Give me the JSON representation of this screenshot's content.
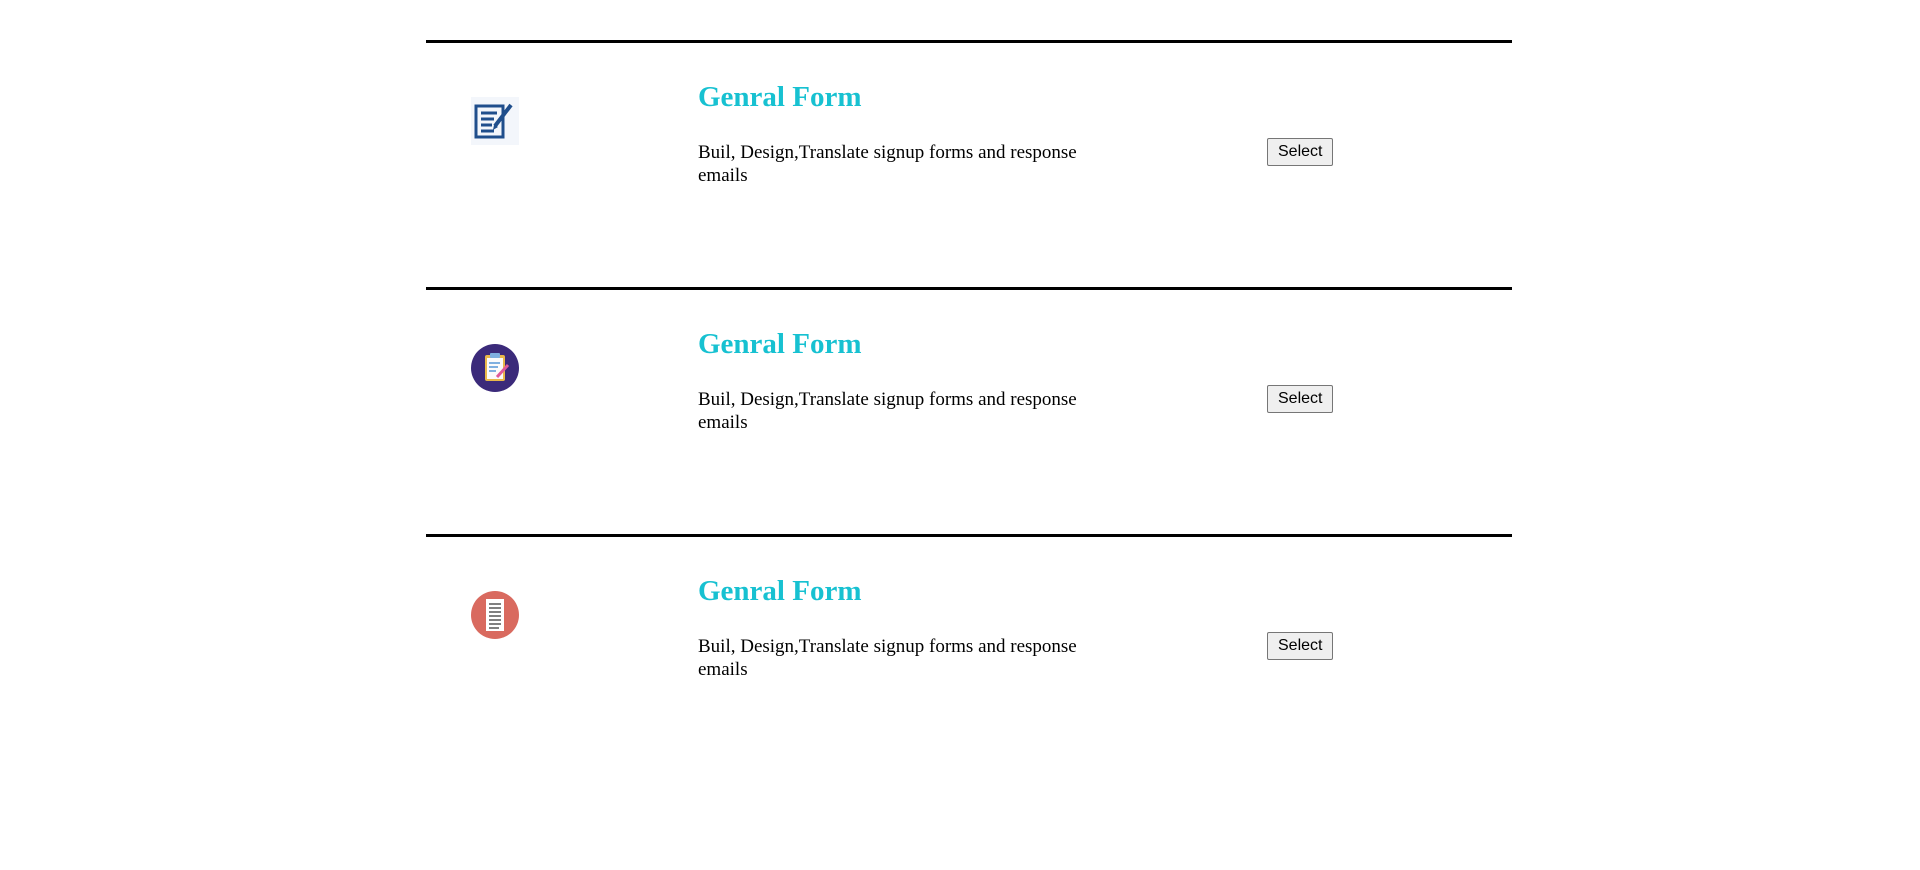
{
  "colors": {
    "title": "#17c1d1",
    "divider": "#000000"
  },
  "cards": [
    {
      "icon": "form-edit-icon",
      "title": "Genral Form",
      "description": "Buil, Design,Translate signup forms and response emails",
      "button_label": "Select"
    },
    {
      "icon": "clipboard-pencil-icon",
      "title": "Genral Form",
      "description": "Buil, Design,Translate signup forms and response emails",
      "button_label": "Select"
    },
    {
      "icon": "document-icon",
      "title": "Genral Form",
      "description": "Buil, Design,Translate signup forms and response emails",
      "button_label": "Select"
    }
  ]
}
